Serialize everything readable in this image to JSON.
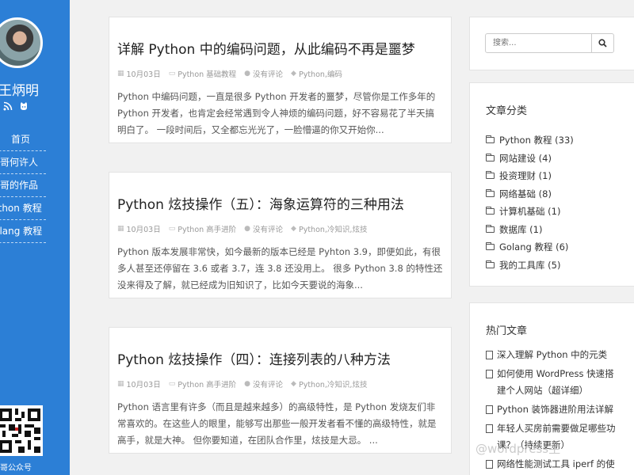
{
  "sidebar": {
    "site_name": "王炳明",
    "nav": [
      "首页",
      "明哥何许人",
      "明哥的作品",
      "Python 教程",
      "Golang 教程"
    ],
    "qr_caption": "明哥公众号"
  },
  "articles": [
    {
      "title": "详解 Python 中的编码问题，从此编码不再是噩梦",
      "date": "10月03日",
      "category": "Python 基础教程",
      "comments": "没有评论",
      "tags": "Python,编码",
      "excerpt": "Python 中编码问题，一直是很多 Python 开发者的噩梦，尽管你是工作多年的 Python 开发者，也肯定会经常遇到令人神烦的编码问题，好不容易花了半天搞明白了。 一段时间后，又全都忘光光了，一脸懵逼的你又开始你..."
    },
    {
      "title": "Python 炫技操作（五）：海象运算符的三种用法",
      "date": "10月03日",
      "category": "Python 高手进阶",
      "comments": "没有评论",
      "tags": "Python,冷知识,炫技",
      "excerpt": "Python 版本发展非常快，如今最新的版本已经是 Pyhton 3.9，即便如此，有很多人甚至还停留在 3.6 或者 3.7，连 3.8 还没用上。 很多 Python 3.8 的特性还没来得及了解，就已经成为旧知识了，比如今天要说的海象..."
    },
    {
      "title": "Python 炫技操作（四）：连接列表的八种方法",
      "date": "10月03日",
      "category": "Python 高手进阶",
      "comments": "没有评论",
      "tags": "Python,冷知识,炫技",
      "excerpt": "Python 语言里有许多（而且是越来越多）的高级特性，是 Python 发烧友们非常喜欢的。在这些人的眼里，能够写出那些一般开发者看不懂的高级特性，就是高手，就是大神。 但你要知道，在团队合作里，炫技是大忌。 ..."
    }
  ],
  "search": {
    "placeholder": "搜索..."
  },
  "categories": {
    "title": "文章分类",
    "items": [
      "Python 教程 (33)",
      "网站建设 (4)",
      "投资理财 (1)",
      "网络基础 (8)",
      "计算机基础 (1)",
      "数据库 (1)",
      "Golang 教程 (6)",
      "我的工具库 (5)"
    ]
  },
  "hot": {
    "title": "热门文章",
    "items": [
      "深入理解 Python 中的元类",
      "如何使用 WordPress 快速搭建个人网站（超详细）",
      "Python 装饰器进阶用法详解",
      "年轻人买房前需要做足哪些功课？（持续更新）",
      "网络性能测试工具 iperf 的使用"
    ]
  },
  "watermark": "@wordpress主",
  "colors": {
    "sidebar": "#2c7fd6",
    "background": "#f1f1f1"
  }
}
